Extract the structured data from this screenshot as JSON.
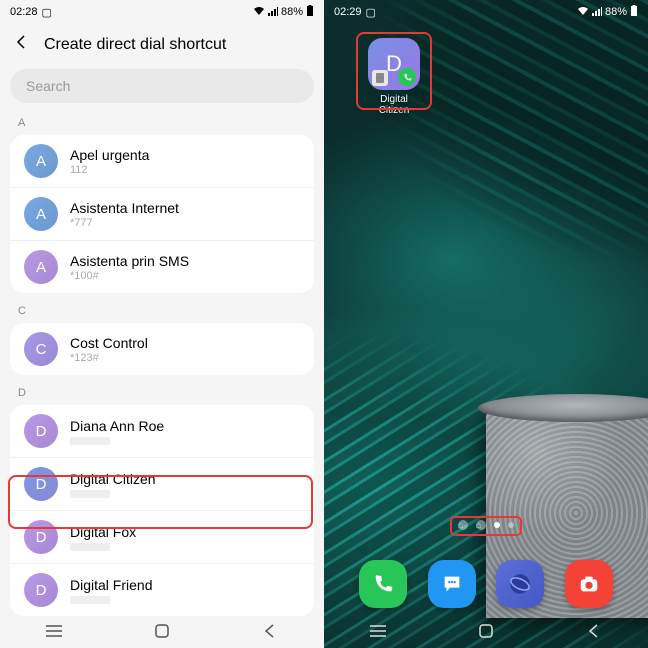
{
  "left": {
    "status": {
      "time": "02:28",
      "battery": "88%"
    },
    "title": "Create direct dial shortcut",
    "search_placeholder": "Search",
    "sections": [
      {
        "letter": "A",
        "items": [
          {
            "name": "Apel urgenta",
            "sub": "112",
            "avatar": "A",
            "cls": "av-a"
          },
          {
            "name": "Asistenta Internet",
            "sub": "*777",
            "avatar": "A",
            "cls": "av-a"
          },
          {
            "name": "Asistenta prin SMS",
            "sub": "*100#",
            "avatar": "A",
            "cls": "av-a2"
          }
        ]
      },
      {
        "letter": "C",
        "items": [
          {
            "name": "Cost Control",
            "sub": "*123#",
            "avatar": "C",
            "cls": "av-c"
          }
        ]
      },
      {
        "letter": "D",
        "items": [
          {
            "name": "Diana Ann Roe",
            "sub": "",
            "avatar": "D",
            "cls": "av-d"
          },
          {
            "name": "Digital Citizen",
            "sub": "",
            "avatar": "D",
            "cls": "av-d2"
          },
          {
            "name": "Digital Fox",
            "sub": "",
            "avatar": "D",
            "cls": "av-d"
          },
          {
            "name": "Digital Friend",
            "sub": "",
            "avatar": "D",
            "cls": "av-d"
          }
        ]
      }
    ]
  },
  "right": {
    "status": {
      "time": "02:29",
      "battery": "88%"
    },
    "shortcut": {
      "letter": "D",
      "label": "Digital Citizen"
    }
  }
}
